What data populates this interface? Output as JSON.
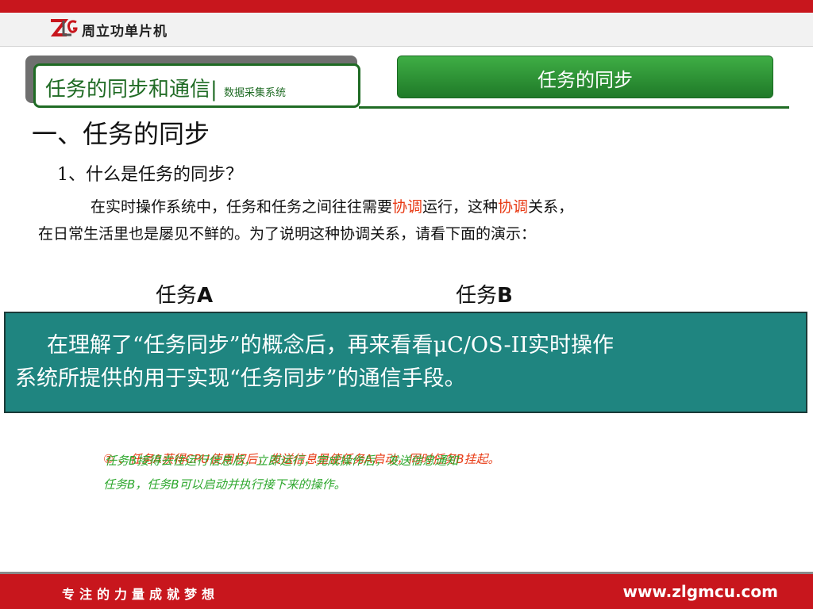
{
  "header": {
    "logo_text": "周立功单片机"
  },
  "title_box": {
    "main": "任务的同步和通信",
    "separator": "|",
    "sub": "数据采集系统"
  },
  "section_bar": {
    "label": "任务的同步"
  },
  "heading1": "一、任务的同步",
  "heading2": "1、什么是任务的同步？",
  "paragraph": {
    "p1": "在实时操作系统中，任务和任务之间往往需要",
    "h1": "协调",
    "p2": "运行，这种",
    "h2": "协调",
    "p3": "关系，",
    "line2": "在日常生活里也是屡见不鲜的。为了说明这种协调关系，请看下面的演示："
  },
  "tasks": {
    "a_prefix": "任务",
    "a_letter": "A",
    "b_prefix": "任务",
    "b_letter": "B"
  },
  "callout": {
    "line1": "在理解了“任务同步”的概念后，再来看看μC/OS-II实时操作",
    "line2": "系统所提供的用于实现“任务同步”的通信手段。"
  },
  "notes": {
    "red": "② 、任务A获得CPU使用权后，发送信息量使任务A启动，同时任务B挂起。",
    "green1": "任务B接得去往运行信息后，立即运行，完成操作后，发送信息通知",
    "green2": "任务B，任务B可以启动并执行接下来的操作。"
  },
  "footer": {
    "slogan": "专注的力量成就梦想",
    "url": "www.zlgmcu.com"
  },
  "colors": {
    "brand_red": "#c8161d",
    "green": "#1f6b24",
    "teal": "#1f8580",
    "highlight": "#e83a14"
  }
}
